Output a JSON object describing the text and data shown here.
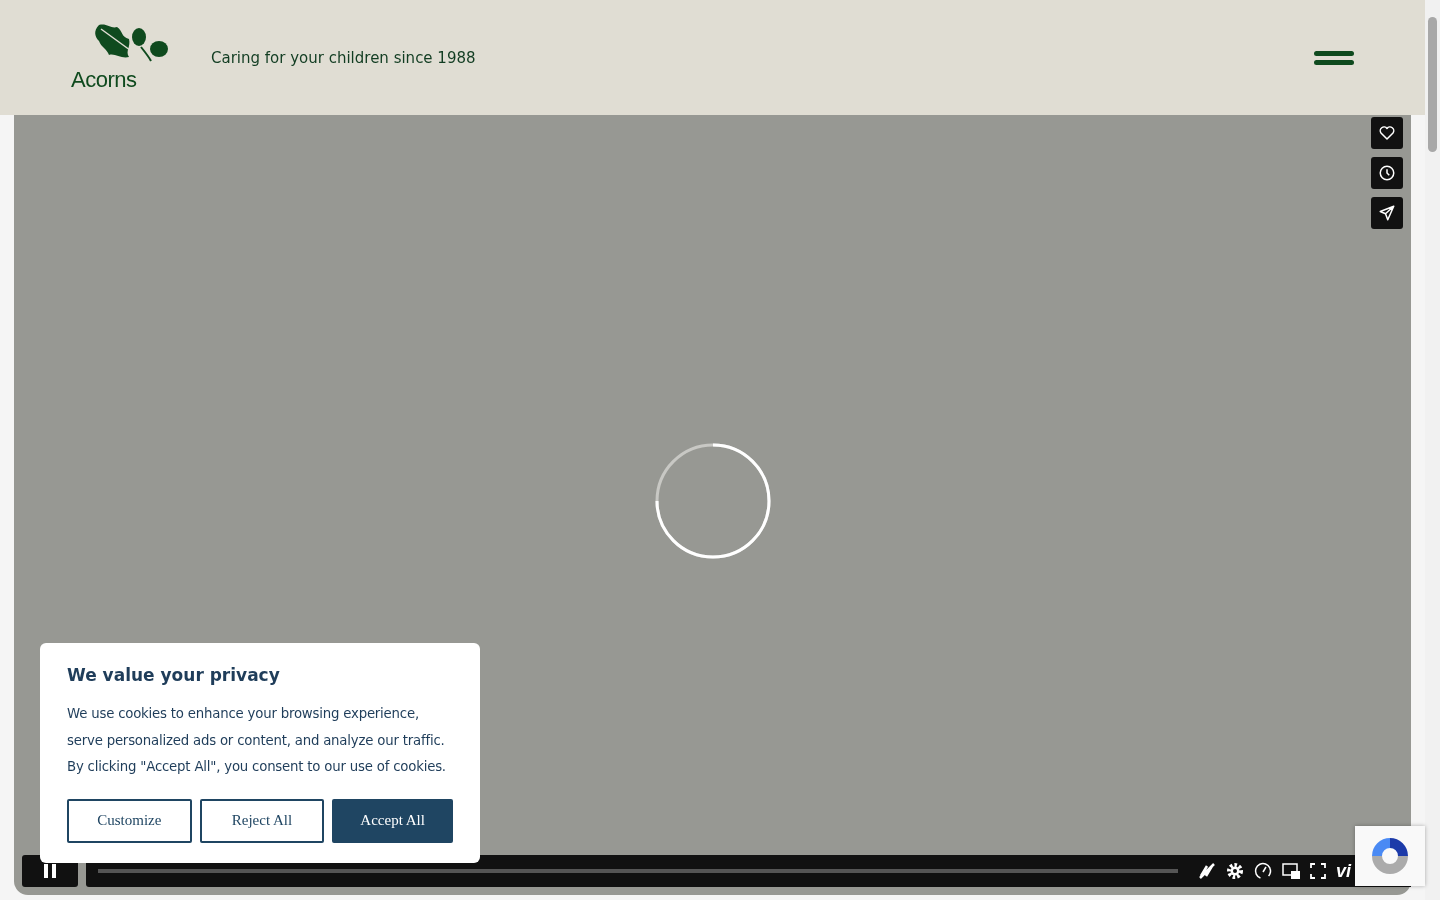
{
  "header": {
    "logo": "Acorns",
    "tagline": "Caring for your children since 1988"
  },
  "player": {
    "loading": true,
    "playing": true,
    "logo": "vi"
  },
  "cookie_banner": {
    "title": "We value your privacy",
    "text": "We use cookies to enhance your browsing experience, serve personalized ads or content, and analyze our traffic. By clicking \"Accept All\", you consent to our use of cookies.",
    "buttons": [
      {
        "label": "Customize",
        "kind": "outline"
      },
      {
        "label": "Reject All",
        "kind": "outline"
      },
      {
        "label": "Accept All",
        "kind": "primary"
      }
    ]
  }
}
